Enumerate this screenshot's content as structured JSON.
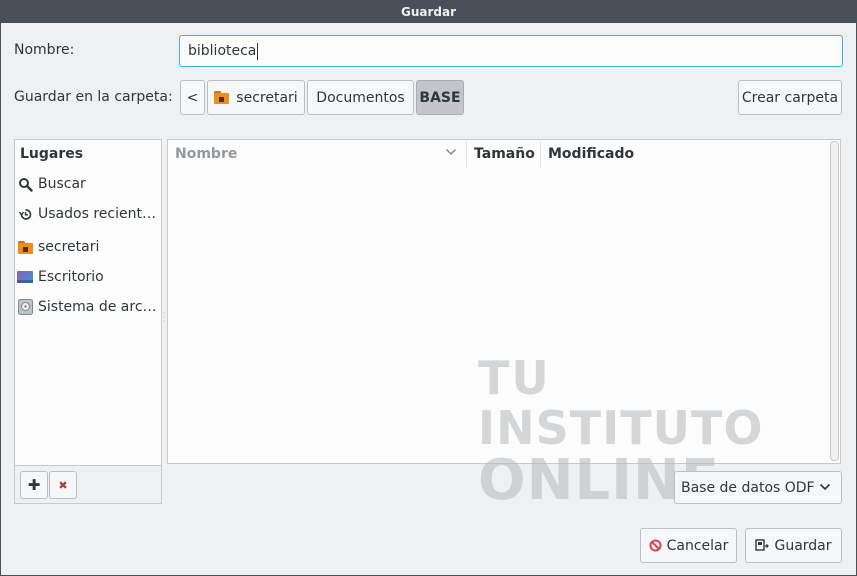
{
  "window": {
    "title": "Guardar"
  },
  "name_row": {
    "label": "Nombre:",
    "value": "biblioteca"
  },
  "folder_row": {
    "label": "Guardar en la carpeta:",
    "back_glyph": "<",
    "path": [
      "secretari",
      "Documentos",
      "BASE"
    ],
    "create_folder": "Crear carpeta"
  },
  "places": {
    "header": "Lugares",
    "items": [
      {
        "label": "Buscar",
        "icon": "search-icon"
      },
      {
        "label": "Usados recient…",
        "icon": "recent-icon"
      },
      {
        "label": "secretari",
        "icon": "home-folder-icon"
      },
      {
        "label": "Escritorio",
        "icon": "desktop-icon"
      },
      {
        "label": "Sistema de arc…",
        "icon": "drive-icon"
      }
    ],
    "add_glyph": "✚",
    "remove_glyph": "✖"
  },
  "files": {
    "columns": [
      "Nombre",
      "Tamaño",
      "Modificado"
    ]
  },
  "watermark": {
    "line1": "TU",
    "line2": "INSTITUTO",
    "line3": "ONLINE"
  },
  "filter": {
    "value": "Base de datos ODF"
  },
  "actions": {
    "cancel": "Cancelar",
    "save": "Guardar"
  },
  "colors": {
    "accent": "#3daee9",
    "titlebar": "#475057",
    "folder": "#e98f22",
    "cancel_icon": "#da4453"
  }
}
